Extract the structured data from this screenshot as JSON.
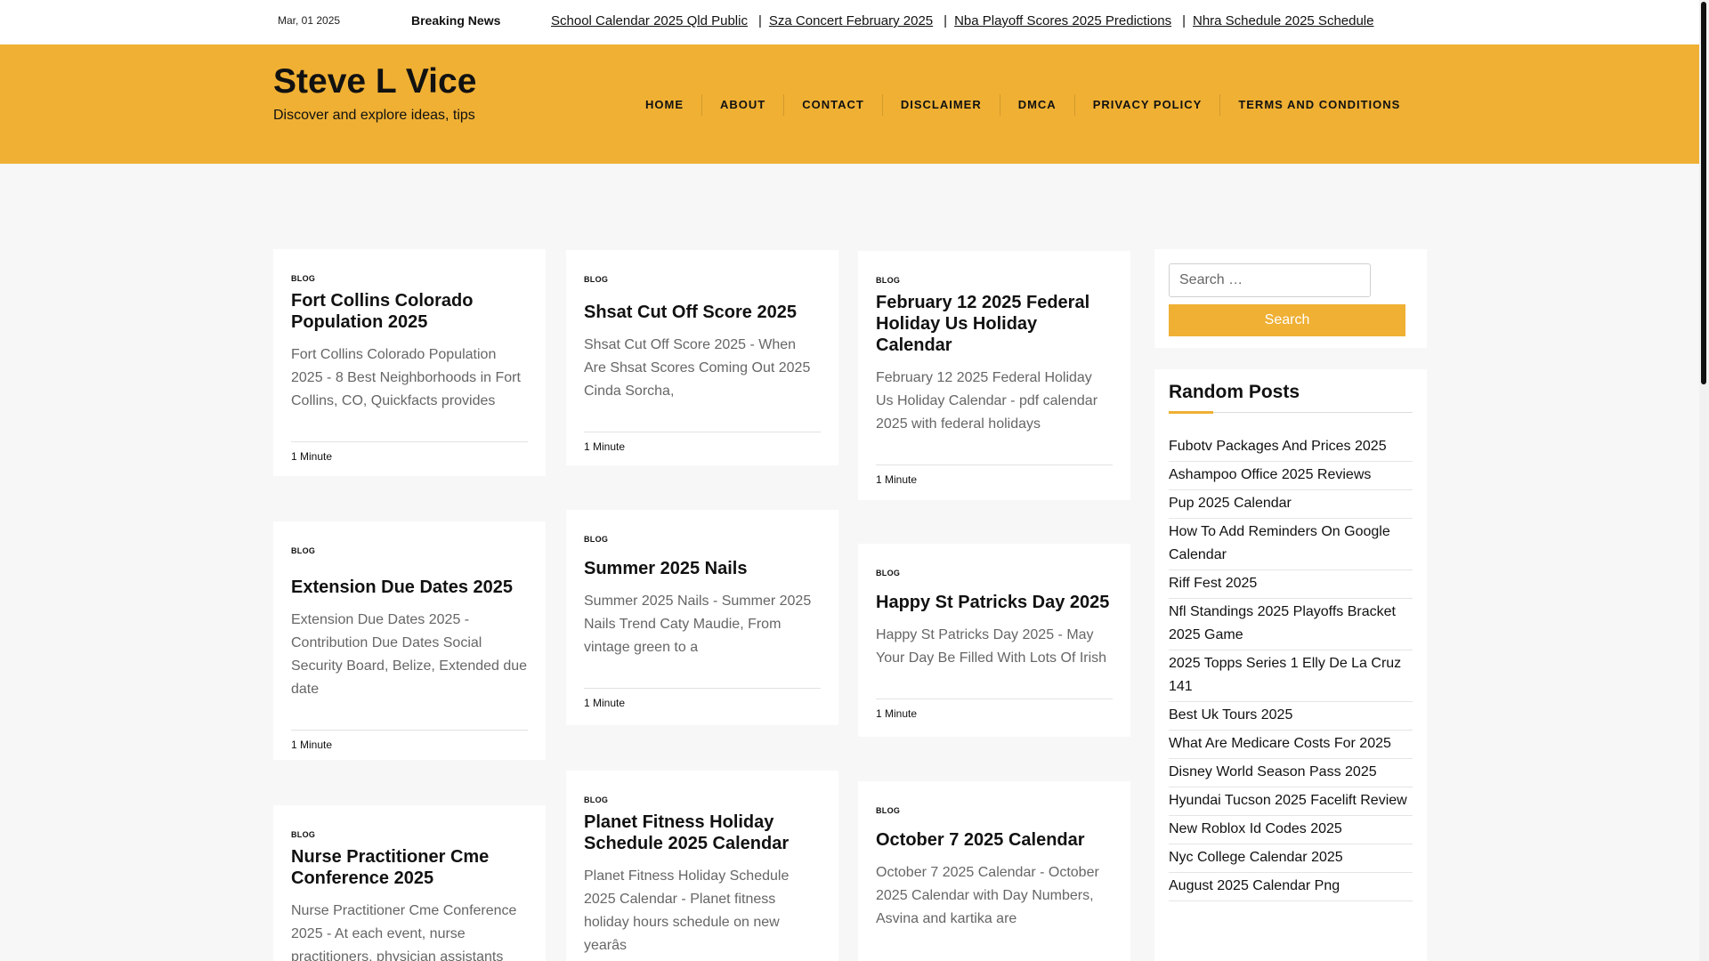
{
  "topbar": {
    "date": "Mar, 01 2025",
    "breaking_label": "Breaking News",
    "ticker": [
      "School Calendar 2025 Qld Public",
      "Sza Concert February 2025",
      "Nba Playoff Scores 2025 Predictions",
      "Nhra Schedule 2025 Schedule"
    ],
    "separator": "|"
  },
  "site": {
    "title": "Steve L Vice",
    "description": "Discover and explore ideas, tips"
  },
  "nav": [
    "HOME",
    "ABOUT",
    "CONTACT",
    "DISCLAIMER",
    "DMCA",
    "PRIVACY POLICY",
    "TERMS AND CONDITIONS"
  ],
  "posts": [
    {
      "category": "BLOG",
      "title": "Fort Collins Colorado Population 2025",
      "excerpt": "Fort Collins Colorado Population 2025 - 8 Best Neighborhoods in Fort Collins, CO, Quickfacts provides",
      "read_time": "1 Minute"
    },
    {
      "category": "BLOG",
      "title": "Shsat Cut Off Score 2025",
      "excerpt": "Shsat Cut Off Score 2025 - When Are Shsat Scores Coming Out 2025 Cinda Sorcha,",
      "read_time": "1 Minute"
    },
    {
      "category": "BLOG",
      "title": "February 12 2025 Federal Holiday Us Holiday Calendar",
      "excerpt": "February 12 2025 Federal Holiday Us Holiday Calendar - pdf calendar 2025 with federal holidays",
      "read_time": "1 Minute"
    },
    {
      "category": "BLOG",
      "title": "Extension Due Dates 2025",
      "excerpt": "Extension Due Dates 2025 - Contribution Due Dates Social Security Board, Belize, Extended due date",
      "read_time": "1 Minute"
    },
    {
      "category": "BLOG",
      "title": "Summer 2025 Nails",
      "excerpt": "Summer 2025 Nails - Summer 2025 Nails Trend Caty Maudie, From vintage green to a",
      "read_time": "1 Minute"
    },
    {
      "category": "BLOG",
      "title": "Happy St Patricks Day 2025",
      "excerpt": "Happy St Patricks Day 2025 - May Your Day Be Filled With Lots Of Irish",
      "read_time": "1 Minute"
    },
    {
      "category": "BLOG",
      "title": "Nurse Practitioner Cme Conference 2025",
      "excerpt": "Nurse Practitioner Cme Conference 2025 - At each event, nurse practitioners, physician assistants",
      "read_time": ""
    },
    {
      "category": "BLOG",
      "title": "Planet Fitness Holiday Schedule 2025 Calendar",
      "excerpt": "Planet Fitness Holiday Schedule 2025 Calendar - Planet fitness holiday hours schedule on new yearâs",
      "read_time": ""
    },
    {
      "category": "BLOG",
      "title": "October 7 2025 Calendar",
      "excerpt": "October 7 2025 Calendar - October 2025 Calendar with Day Numbers, Asvina and kartika are",
      "read_time": ""
    }
  ],
  "search": {
    "placeholder": "Search …",
    "button_label": "Search"
  },
  "random_posts": {
    "title": "Random Posts",
    "items": [
      "Fubotv Packages And Prices 2025",
      "Ashampoo Office 2025 Reviews",
      "Pup 2025 Calendar",
      "How To Add Reminders On Google Calendar",
      "Riff Fest 2025",
      "Nfl Standings 2025 Playoffs Bracket 2025 Game",
      "2025 Topps Series 1 Elly De La Cruz 141",
      "Best Uk Tours 2025",
      "What Are Medicare Costs For 2025",
      "Disney World Season Pass 2025",
      "Hyundai Tucson 2025 Facelift Review",
      "New Roblox Id Codes 2025",
      "Nyc College Calendar 2025",
      "August 2025 Calendar Png"
    ]
  },
  "colors": {
    "accent": "#efb034",
    "background": "#f7f7f7",
    "card": "#ffffff",
    "excerpt_text": "#666666"
  }
}
